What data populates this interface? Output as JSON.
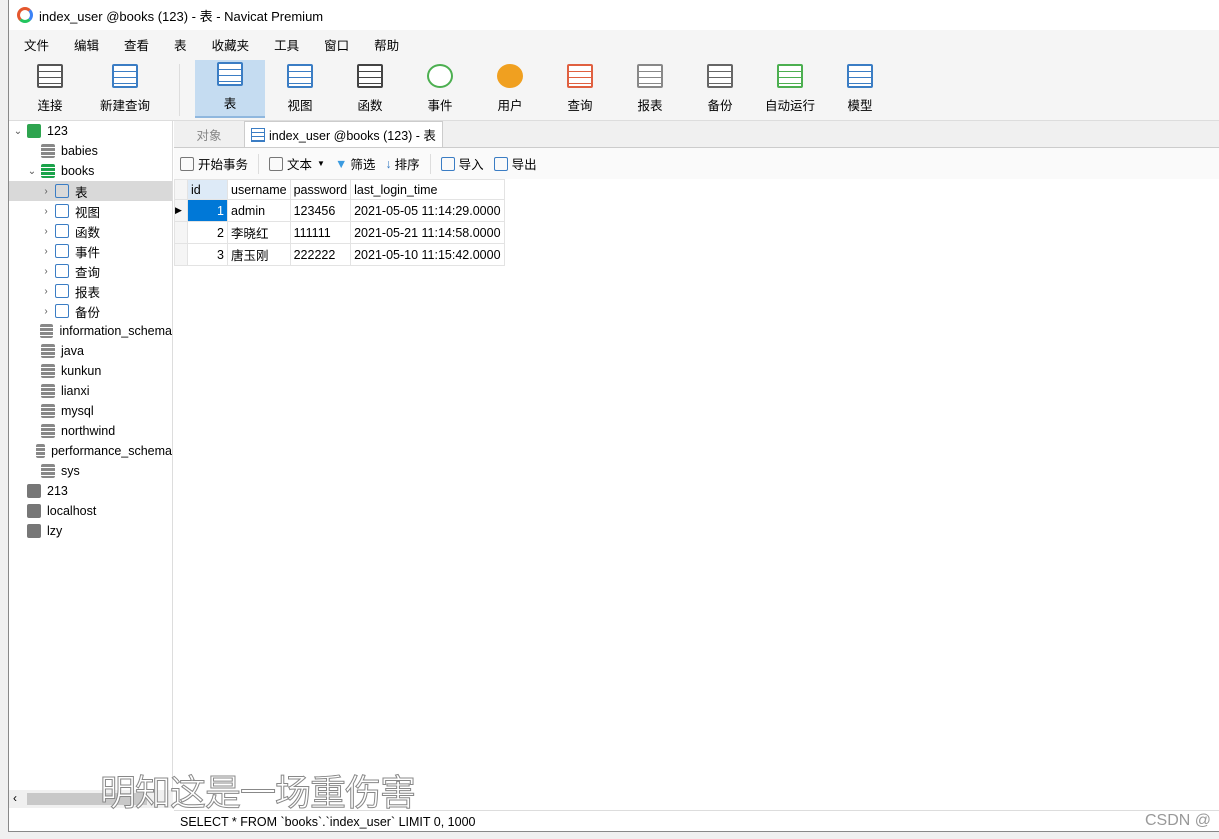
{
  "window": {
    "title": "index_user @books (123) - 表 - Navicat Premium"
  },
  "menu": [
    "文件",
    "编辑",
    "查看",
    "表",
    "收藏夹",
    "工具",
    "窗口",
    "帮助"
  ],
  "toolbar": [
    {
      "label": "连接",
      "icon": "connect-plug-icon",
      "color": "#555555"
    },
    {
      "label": "新建查询",
      "icon": "new-query-icon",
      "color": "#3b7dc4"
    },
    {
      "label": "表",
      "icon": "table-icon",
      "color": "#3b7dc4",
      "active": true
    },
    {
      "label": "视图",
      "icon": "view-icon",
      "color": "#3b7dc4"
    },
    {
      "label": "函数",
      "icon": "function-icon",
      "color": "#444444"
    },
    {
      "label": "事件",
      "icon": "clock-icon",
      "color": "#4caf50"
    },
    {
      "label": "用户",
      "icon": "user-icon",
      "color": "#f0a020"
    },
    {
      "label": "查询",
      "icon": "query-icon",
      "color": "#e06040"
    },
    {
      "label": "报表",
      "icon": "report-icon",
      "color": "#888888"
    },
    {
      "label": "备份",
      "icon": "backup-icon",
      "color": "#666666"
    },
    {
      "label": "自动运行",
      "icon": "automation-icon",
      "color": "#4caf50"
    },
    {
      "label": "模型",
      "icon": "model-icon",
      "color": "#3b7dc4"
    }
  ],
  "tree": [
    {
      "label": "123",
      "type": "conn",
      "level": 0,
      "chevron": "⌄"
    },
    {
      "label": "babies",
      "type": "db",
      "level": 1
    },
    {
      "label": "books",
      "type": "dbg",
      "level": 1,
      "chevron": "⌄"
    },
    {
      "label": "表",
      "type": "obj",
      "level": 2,
      "chevron": "›",
      "selected": true
    },
    {
      "label": "视图",
      "type": "obj",
      "level": 2,
      "chevron": "›"
    },
    {
      "label": "函数",
      "type": "obj",
      "level": 2,
      "chevron": "›"
    },
    {
      "label": "事件",
      "type": "obj",
      "level": 2,
      "chevron": "›"
    },
    {
      "label": "查询",
      "type": "obj",
      "level": 2,
      "chevron": "›"
    },
    {
      "label": "报表",
      "type": "obj",
      "level": 2,
      "chevron": "›"
    },
    {
      "label": "备份",
      "type": "obj",
      "level": 2,
      "chevron": "›"
    },
    {
      "label": "information_schema",
      "type": "db",
      "level": 1
    },
    {
      "label": "java",
      "type": "db",
      "level": 1
    },
    {
      "label": "kunkun",
      "type": "db",
      "level": 1
    },
    {
      "label": "lianxi",
      "type": "db",
      "level": 1
    },
    {
      "label": "mysql",
      "type": "db",
      "level": 1
    },
    {
      "label": "northwind",
      "type": "db",
      "level": 1
    },
    {
      "label": "performance_schema",
      "type": "db",
      "level": 1
    },
    {
      "label": "sys",
      "type": "db",
      "level": 1
    },
    {
      "label": "213",
      "type": "conng",
      "level": 0
    },
    {
      "label": "localhost",
      "type": "conng",
      "level": 0
    },
    {
      "label": "lzy",
      "type": "conng",
      "level": 0
    }
  ],
  "tabs": {
    "objects": "对象",
    "active": "index_user @books (123) - 表"
  },
  "subtoolbar": {
    "begin_transaction": "开始事务",
    "text": "文本",
    "filter": "筛选",
    "sort": "排序",
    "import": "导入",
    "export": "导出"
  },
  "grid": {
    "columns": [
      "id",
      "username",
      "password",
      "last_login_time"
    ],
    "rows": [
      [
        "1",
        "admin",
        "123456",
        "2021-05-05 11:14:29.0000"
      ],
      [
        "2",
        "李晓红",
        "111111",
        "2021-05-21 11:14:58.0000"
      ],
      [
        "3",
        "唐玉刚",
        "222222",
        "2021-05-10 11:15:42.0000"
      ]
    ]
  },
  "status": {
    "sql": "SELECT * FROM `books`.`index_user` LIMIT 0, 1000"
  },
  "overlay_caption": "明知这是一场重伤害",
  "watermark": "CSDN @"
}
